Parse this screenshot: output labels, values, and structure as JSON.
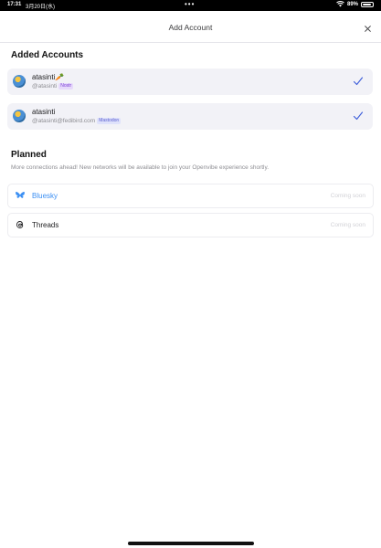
{
  "status_bar": {
    "time": "17:31",
    "date": "3月20日(水)",
    "dots": "•••",
    "battery_text": "89%",
    "battery_level": 0.89
  },
  "sheet": {
    "title": "Add Account",
    "close_icon": "close-icon"
  },
  "added": {
    "title": "Added Accounts",
    "accounts": [
      {
        "name": "atasinti🥕",
        "handle": "@atasinti",
        "network": "Nostr",
        "selected": true
      },
      {
        "name": "atasinti",
        "handle": "@atasinti@fedibird.com",
        "network": "Mastodon",
        "selected": true
      }
    ]
  },
  "planned": {
    "title": "Planned",
    "description": "More connections ahead! New networks will be available to join your Openvibe experience shortly.",
    "networks": [
      {
        "name": "Bluesky",
        "status": "Coming soon",
        "icon": "butterfly-icon",
        "color": "#3b8ff3"
      },
      {
        "name": "Threads",
        "status": "Coming soon",
        "icon": "threads-icon",
        "color": "#1c1c1e"
      }
    ]
  },
  "colors": {
    "accent": "#3a5bd9",
    "card_bg": "#f2f2f7"
  }
}
